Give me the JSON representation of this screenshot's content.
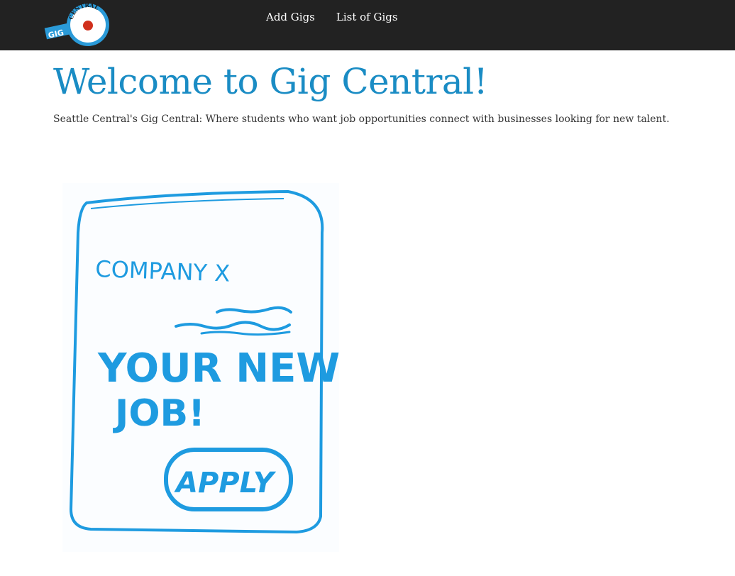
{
  "header": {
    "logo_text_top": "CENTRAL",
    "logo_text_side": "GIG",
    "nav": [
      {
        "label": "Add Gigs"
      },
      {
        "label": "List of Gigs"
      }
    ]
  },
  "main": {
    "title": "Welcome to Gig Central!",
    "tagline": "Seattle Central's Gig Central: Where students who want job opportunities connect with businesses looking for new talent."
  },
  "illustration": {
    "line1": "COMPANY X",
    "line2": "YOUR NEW",
    "line3": "JOB!",
    "button_text": "APPLY"
  },
  "colors": {
    "navbar": "#222222",
    "title": "#1a8cc4",
    "sketch_ink": "#1e9be0",
    "logo_dot": "#d0301c"
  }
}
